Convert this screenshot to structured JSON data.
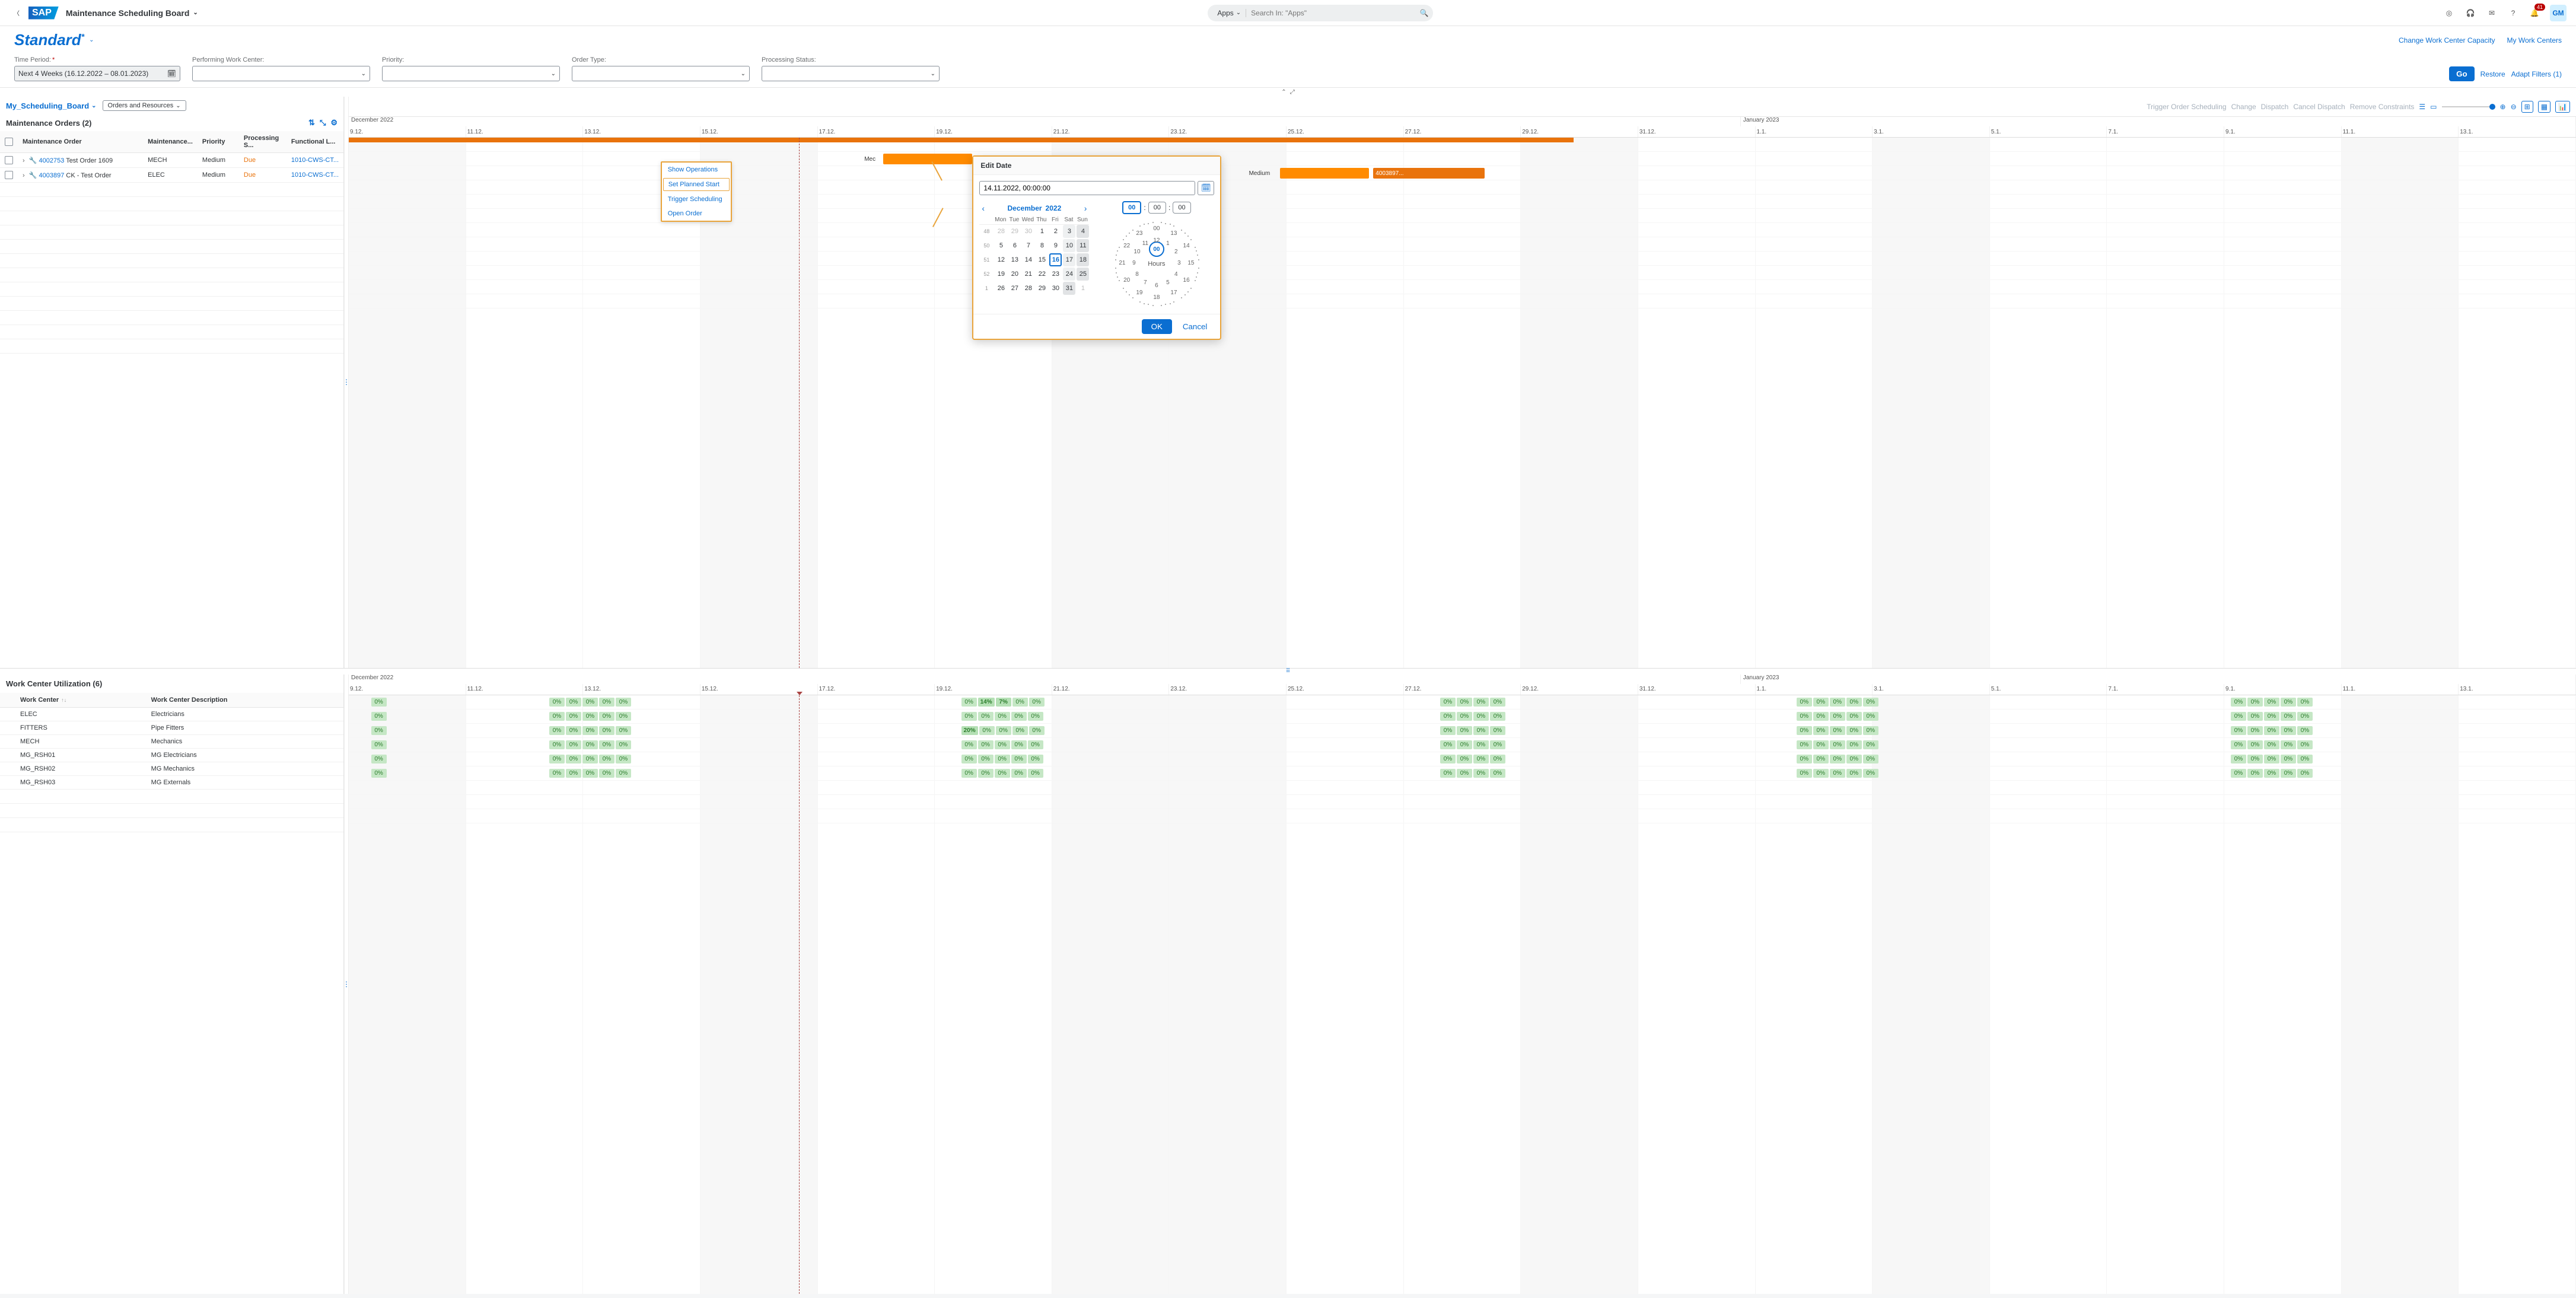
{
  "shell": {
    "logo": "SAP",
    "title": "Maintenance Scheduling Board",
    "search_scope": "Apps",
    "search_placeholder": "Search In: \"Apps\"",
    "notification_count": "41",
    "avatar": "GM"
  },
  "page": {
    "variant": "Standard",
    "links": {
      "change_capacity": "Change Work Center Capacity",
      "my_work_centers": "My Work Centers"
    }
  },
  "filters": {
    "time_period_label": "Time Period:",
    "time_period_value": "Next 4 Weeks (16.12.2022 – 08.01.2023)",
    "performing_wc_label": "Performing Work Center:",
    "priority_label": "Priority:",
    "order_type_label": "Order Type:",
    "processing_status_label": "Processing Status:",
    "go": "Go",
    "restore": "Restore",
    "adapt": "Adapt Filters (1)"
  },
  "board": {
    "tab": "My_Scheduling_Board",
    "view_select": "Orders and Resources",
    "orders_title": "Maintenance Orders (2)",
    "columns": {
      "order": "Maintenance Order",
      "maint": "Maintenance...",
      "priority": "Priority",
      "processing": "Processing S...",
      "funcloc": "Functional L..."
    },
    "rows": [
      {
        "order_no": "4002753",
        "desc": "Test Order 1609",
        "wc": "MECH",
        "prio": "Medium",
        "status": "Due",
        "floc": "1010-CWS-CT..."
      },
      {
        "order_no": "4003897",
        "desc": "CK - Test Order",
        "wc": "ELEC",
        "prio": "Medium",
        "status": "Due",
        "floc": "1010-CWS-CT..."
      }
    ]
  },
  "gantt_toolbar": {
    "trigger": "Trigger Order Scheduling",
    "change": "Change",
    "dispatch": "Dispatch",
    "cancel_dispatch": "Cancel Dispatch",
    "remove": "Remove Constraints"
  },
  "timeline": {
    "month1": "December 2022",
    "month2": "January 2023",
    "days": [
      "9.12.",
      "11.12.",
      "13.12.",
      "15.12.",
      "17.12.",
      "19.12.",
      "21.12.",
      "23.12.",
      "25.12.",
      "27.12.",
      "29.12.",
      "31.12.",
      "1.1.",
      "3.1.",
      "5.1.",
      "7.1.",
      "9.1.",
      "11.1.",
      "13.1."
    ]
  },
  "context_menu": {
    "show_ops": "Show Operations",
    "set_start": "Set Planned Start",
    "trigger": "Trigger Scheduling",
    "open": "Open Order"
  },
  "gantt": {
    "bar1_label": "Medium",
    "bar1_meta": "Mec",
    "bar2_label": "4003897...",
    "bar2_meta": "Medium"
  },
  "edit_date": {
    "title": "Edit Date",
    "value": "14.11.2022, 00:00:00",
    "month": "December",
    "year": "2022",
    "dow": [
      "Mon",
      "Tue",
      "Wed",
      "Thu",
      "Fri",
      "Sat",
      "Sun"
    ],
    "weeks": [
      {
        "wk": "48",
        "d": [
          "28",
          "29",
          "30",
          "1",
          "2",
          "3",
          "4"
        ],
        "cls": [
          "o",
          "o",
          "o",
          "",
          "",
          "r",
          "rd"
        ]
      },
      {
        "wk": "50",
        "d": [
          "5",
          "6",
          "7",
          "8",
          "9",
          "10",
          "11"
        ],
        "cls": [
          "",
          "",
          "",
          "",
          "",
          "r",
          "rd"
        ]
      },
      {
        "wk": "51",
        "d": [
          "12",
          "13",
          "14",
          "15",
          "16",
          "17",
          "18"
        ],
        "cls": [
          "",
          "",
          "",
          "",
          "t",
          "r",
          "rd"
        ]
      },
      {
        "wk": "52",
        "d": [
          "19",
          "20",
          "21",
          "22",
          "23",
          "24",
          "25"
        ],
        "cls": [
          "",
          "",
          "",
          "",
          "",
          "r",
          "rd"
        ]
      },
      {
        "wk": "1",
        "d": [
          "26",
          "27",
          "28",
          "29",
          "30",
          "31",
          "1"
        ],
        "cls": [
          "",
          "",
          "",
          "",
          "",
          "rd",
          "o"
        ]
      }
    ],
    "time": {
      "h": "00",
      "m": "00",
      "s": "00"
    },
    "clock_center": "00",
    "clock_label": "Hours",
    "inner_hours": [
      "12",
      "1",
      "2",
      "3",
      "4",
      "5",
      "6",
      "7",
      "8",
      "9",
      "10",
      "11"
    ],
    "outer_hours": [
      "00",
      "13",
      "14",
      "15",
      "16",
      "17",
      "18",
      "19",
      "20",
      "21",
      "22",
      "23"
    ],
    "ok": "OK",
    "cancel": "Cancel"
  },
  "work_centers": {
    "title": "Work Center Utilization (6)",
    "col_wc": "Work Center",
    "col_desc": "Work Center Description",
    "rows": [
      {
        "wc": "ELEC",
        "desc": "Electricians"
      },
      {
        "wc": "FITTERS",
        "desc": "Pipe Fitters"
      },
      {
        "wc": "MECH",
        "desc": "Mechanics"
      },
      {
        "wc": "MG_RSH01",
        "desc": "MG Electricians"
      },
      {
        "wc": "MG_RSH02",
        "desc": "MG Mechanics"
      },
      {
        "wc": "MG_RSH03",
        "desc": "MG Externals"
      }
    ]
  },
  "utilization": {
    "rows": [
      {
        "g0": [
          "0%"
        ],
        "g1": [
          "0%",
          "0%",
          "0%",
          "0%",
          "0%"
        ],
        "g2": [
          "0%",
          "14%",
          "7%",
          "0%",
          "0%"
        ],
        "g3": [
          "0%",
          "0%",
          "0%",
          "0%"
        ],
        "g4": [
          "0%",
          "0%",
          "0%",
          "0%",
          "0%"
        ],
        "g5": [
          "0%",
          "0%",
          "0%",
          "0%",
          "0%"
        ]
      },
      {
        "g0": [
          "0%"
        ],
        "g1": [
          "0%",
          "0%",
          "0%",
          "0%",
          "0%"
        ],
        "g2": [
          "0%",
          "0%",
          "0%",
          "0%",
          "0%"
        ],
        "g3": [
          "0%",
          "0%",
          "0%",
          "0%"
        ],
        "g4": [
          "0%",
          "0%",
          "0%",
          "0%",
          "0%"
        ],
        "g5": [
          "0%",
          "0%",
          "0%",
          "0%",
          "0%"
        ]
      },
      {
        "g0": [
          "0%"
        ],
        "g1": [
          "0%",
          "0%",
          "0%",
          "0%",
          "0%"
        ],
        "g2": [
          "20%",
          "0%",
          "0%",
          "0%",
          "0%"
        ],
        "g3": [
          "0%",
          "0%",
          "0%",
          "0%"
        ],
        "g4": [
          "0%",
          "0%",
          "0%",
          "0%",
          "0%"
        ],
        "g5": [
          "0%",
          "0%",
          "0%",
          "0%",
          "0%"
        ]
      },
      {
        "g0": [
          "0%"
        ],
        "g1": [
          "0%",
          "0%",
          "0%",
          "0%",
          "0%"
        ],
        "g2": [
          "0%",
          "0%",
          "0%",
          "0%",
          "0%"
        ],
        "g3": [
          "0%",
          "0%",
          "0%",
          "0%"
        ],
        "g4": [
          "0%",
          "0%",
          "0%",
          "0%",
          "0%"
        ],
        "g5": [
          "0%",
          "0%",
          "0%",
          "0%",
          "0%"
        ]
      },
      {
        "g0": [
          "0%"
        ],
        "g1": [
          "0%",
          "0%",
          "0%",
          "0%",
          "0%"
        ],
        "g2": [
          "0%",
          "0%",
          "0%",
          "0%",
          "0%"
        ],
        "g3": [
          "0%",
          "0%",
          "0%",
          "0%"
        ],
        "g4": [
          "0%",
          "0%",
          "0%",
          "0%",
          "0%"
        ],
        "g5": [
          "0%",
          "0%",
          "0%",
          "0%",
          "0%"
        ]
      },
      {
        "g0": [
          "0%"
        ],
        "g1": [
          "0%",
          "0%",
          "0%",
          "0%",
          "0%"
        ],
        "g2": [
          "0%",
          "0%",
          "0%",
          "0%",
          "0%"
        ],
        "g3": [
          "0%",
          "0%",
          "0%",
          "0%"
        ],
        "g4": [
          "0%",
          "0%",
          "0%",
          "0%",
          "0%"
        ],
        "g5": [
          "0%",
          "0%",
          "0%",
          "0%",
          "0%"
        ]
      }
    ]
  }
}
